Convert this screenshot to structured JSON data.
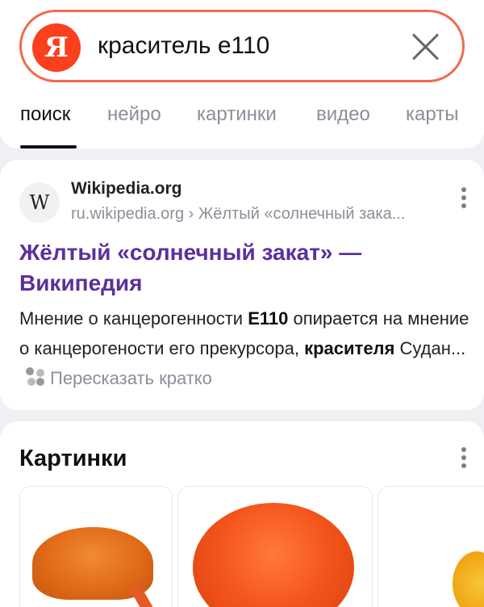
{
  "search": {
    "logo_letter": "Я",
    "query": "краситель е110"
  },
  "tabs": [
    {
      "label": "поиск",
      "active": true
    },
    {
      "label": "нейро"
    },
    {
      "label": "картинки"
    },
    {
      "label": "видео"
    },
    {
      "label": "карты"
    }
  ],
  "result": {
    "favicon_letter": "W",
    "site_name": "Wikipedia.org",
    "breadcrumb": "ru.wikipedia.org › Жёлтый «солнечный зака...",
    "title": "Жёлтый «солнечный закат» — Википедия",
    "snippet": {
      "part1": "Мнение о канцерогенности ",
      "bold1": "Е110",
      "part2": " опирается на мнение о канцерогености его прекурсора, ",
      "bold2": "красителя",
      "part3": " Судан..."
    },
    "retell_label": "Пересказать кратко"
  },
  "images_section": {
    "title": "Картинки"
  },
  "colors": {
    "accent": "#fc3f1d",
    "link": "#5b2f9e",
    "search_border": "#f26a4f"
  },
  "icons": [
    "yandex-logo",
    "close-icon",
    "wikipedia-icon",
    "more-vertical-icon",
    "retell-icon"
  ]
}
